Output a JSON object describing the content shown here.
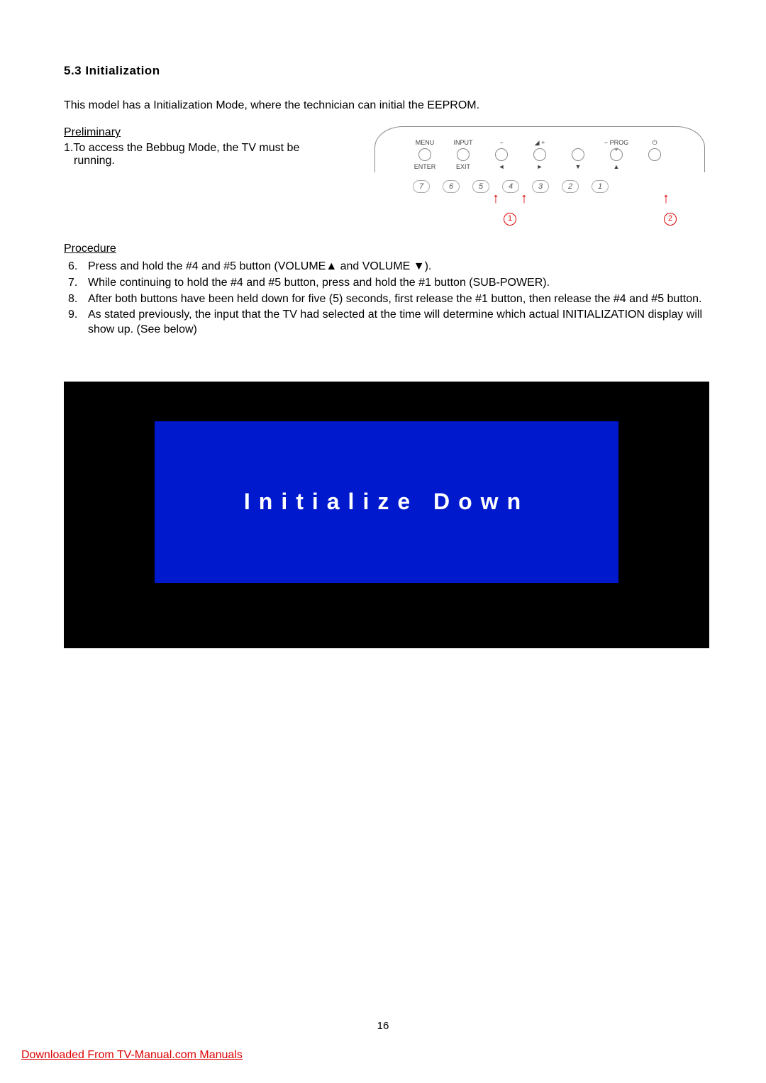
{
  "section_title": "5.3 Initialization",
  "intro": "This model has a Initialization Mode, where the technician can initial the EEPROM.",
  "preliminary": {
    "heading": "Preliminary",
    "item": "1.To access the Bebbug Mode, the TV must be running."
  },
  "panel": {
    "buttons": [
      {
        "top": "MENU",
        "bottom": "ENTER"
      },
      {
        "top": "INPUT",
        "bottom": "EXIT"
      },
      {
        "top": "−",
        "bottom": "◄"
      },
      {
        "top": "◢  +",
        "bottom": "►"
      },
      {
        "top": "",
        "bottom": "▼"
      },
      {
        "top": "−  PROG  +",
        "bottom": "▲"
      },
      {
        "top": "⏻",
        "bottom": ""
      }
    ],
    "numbers": [
      "7",
      "6",
      "5",
      "4",
      "3",
      "2",
      "1"
    ],
    "callout1": "1",
    "callout2": "2"
  },
  "procedure": {
    "heading": "Procedure",
    "steps": [
      "Press and hold the #4 and #5 button (VOLUME▲ and VOLUME ▼).",
      "While continuing to hold the #4 and #5 button, press and hold the #1 button (SUB-POWER).",
      "After both buttons have been held down for five (5) seconds, first release the #1 button, then release the #4 and #5 button.",
      "As stated previously, the input that the TV had selected at the time will determine which actual INITIALIZATION display will show up. (See below)"
    ]
  },
  "screenshot_text": "Initialize Down",
  "page_number": "16",
  "footer_link": "Downloaded From TV-Manual.com Manuals"
}
